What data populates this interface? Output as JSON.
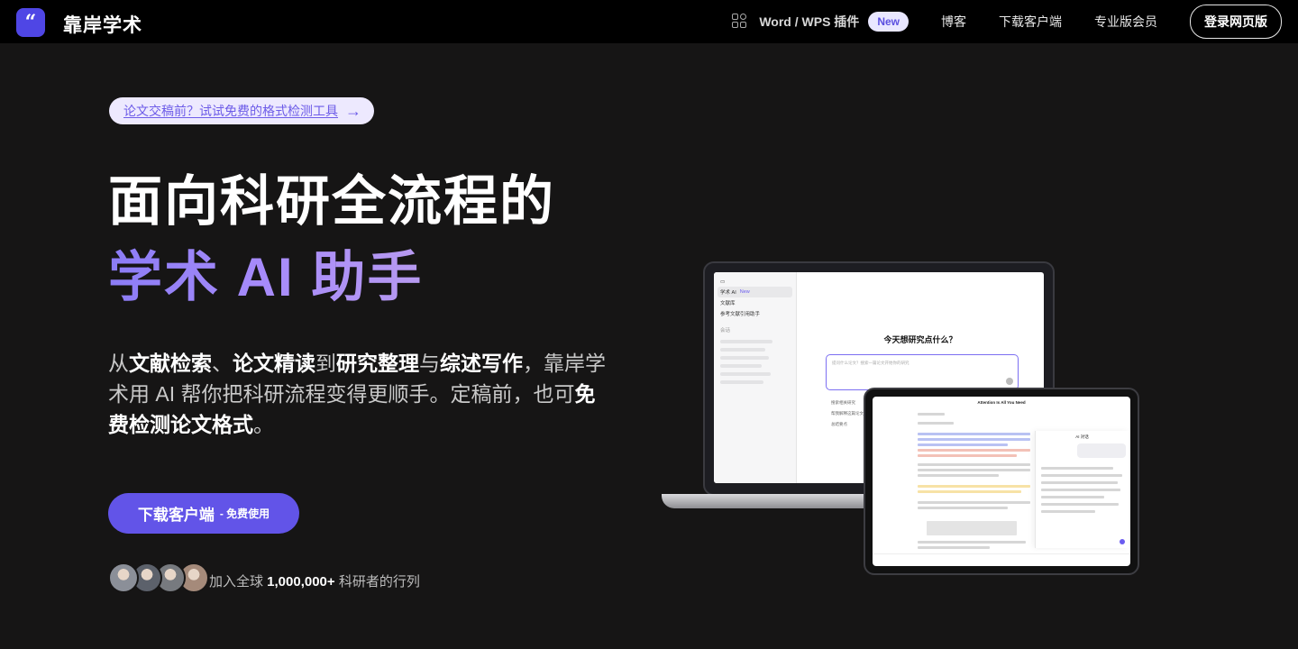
{
  "nav": {
    "brand": "靠岸学术",
    "logo_icon": "quote-icon",
    "plugin_label": "Word / WPS 插件",
    "new_badge": "New",
    "links": [
      "博客",
      "下载客户端",
      "专业版会员"
    ],
    "login_label": "登录网页版"
  },
  "hero": {
    "promo_text": "论文交稿前？试试免费的格式检测工具",
    "promo_arrow": "→",
    "title_line1": "面向科研全流程的",
    "title_line2": "学术 AI 助手",
    "desc_parts": [
      {
        "t": "从",
        "b": false
      },
      {
        "t": "文献检索",
        "b": true
      },
      {
        "t": "、",
        "b": false
      },
      {
        "t": "论文精读",
        "b": true
      },
      {
        "t": "到",
        "b": false
      },
      {
        "t": "研究整理",
        "b": true
      },
      {
        "t": "与",
        "b": false
      },
      {
        "t": "综述写作",
        "b": true
      },
      {
        "t": "，靠岸学术用 AI 帮你把科研流程变得更顺手。定稿前，也可",
        "b": false
      },
      {
        "t": "免费检测论文格式",
        "b": true
      },
      {
        "t": "。",
        "b": false
      }
    ],
    "cta_main": "下载客户端",
    "cta_sub": "- 免费使用",
    "join_prefix": "加入全球 ",
    "join_count": "1,000,000+",
    "join_suffix": " 科研者的行列"
  },
  "avatars": [
    "#8b8f98",
    "#5c616b",
    "#777a7f",
    "#a58a7a"
  ],
  "laptop_screen": {
    "sidebar_items": [
      "学术 AI",
      "文献库",
      "参考文献引用助手",
      "会话"
    ],
    "badge": "New",
    "main_title": "今天想研究点什么？",
    "input_placeholder": "提问什么论文？搜索一篇论文开始你的研究",
    "hints": [
      "搜索相关研究",
      "帮我解释这篇论文",
      "总结要点"
    ]
  },
  "tablet_screen": {
    "doc_title": "Attention Is All You Need",
    "panel_title": "AI 对话"
  },
  "colors": {
    "accent": "#6254e8",
    "gradient_start": "#8b7cf6",
    "gradient_end": "#b79af0"
  }
}
